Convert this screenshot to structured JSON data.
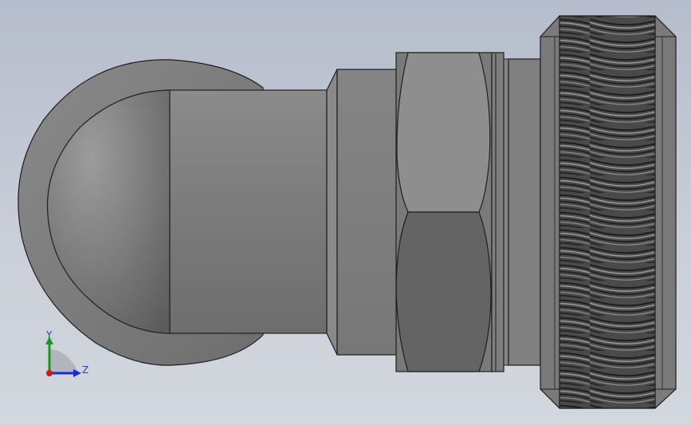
{
  "viewport": {
    "background_top": "#b5bccb",
    "background_bottom": "#d3d7de"
  },
  "model": {
    "body_color": "#7c7c7c",
    "edge_color": "#1e1e1e",
    "hex_face_light": "#8e8e8e",
    "hex_face_dark": "#666666",
    "knurl_dark": "#2a2a2a",
    "knurl_light": "#9a9a9a"
  },
  "triad": {
    "y_label": "Y",
    "z_label": "Z",
    "y_color": "#1a9a1a",
    "z_color": "#1a2bd0",
    "x_color": "#d01a1a"
  }
}
